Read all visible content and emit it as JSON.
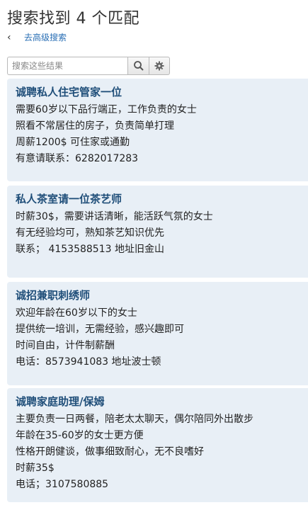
{
  "header": {
    "title": "搜索找到 4 个匹配",
    "back_label": "去高级搜索"
  },
  "search": {
    "placeholder": "搜索这些结果",
    "search_icon": "search-icon",
    "settings_icon": "gear-icon"
  },
  "results": [
    {
      "title": "诚聘私人住宅管家一位",
      "lines": [
        "需要60岁以下品行端正，工作负责的女士",
        "照看不常居住的房子，负责简单打理",
        "周薪1200$ 可住家或通勤",
        "有意请联系：6282017283"
      ]
    },
    {
      "title": "私人茶室请一位茶艺师",
      "lines": [
        "时薪30$，需要讲话清晰，能活跃气氛的女士",
        "有无经验均可，熟知茶艺知识优先",
        "联系； 4153588513 地址旧金山"
      ]
    },
    {
      "title": "诚招兼职刺绣师",
      "lines": [
        "欢迎年龄在60岁以下的女士",
        "提供统一培训，无需经验，感兴趣即可",
        "时间自由，计件制薪酬",
        "电话：8573941083 地址波士顿"
      ]
    },
    {
      "title": "诚聘家庭助理/保姆",
      "lines": [
        "主要负责一日两餐，陪老太太聊天，偶尔陪同外出散步",
        "年龄在35-60岁的女士更方便",
        "性格开朗健谈，做事细致耐心，无不良嗜好",
        "时薪35$",
        "电话；3107580885"
      ]
    }
  ]
}
